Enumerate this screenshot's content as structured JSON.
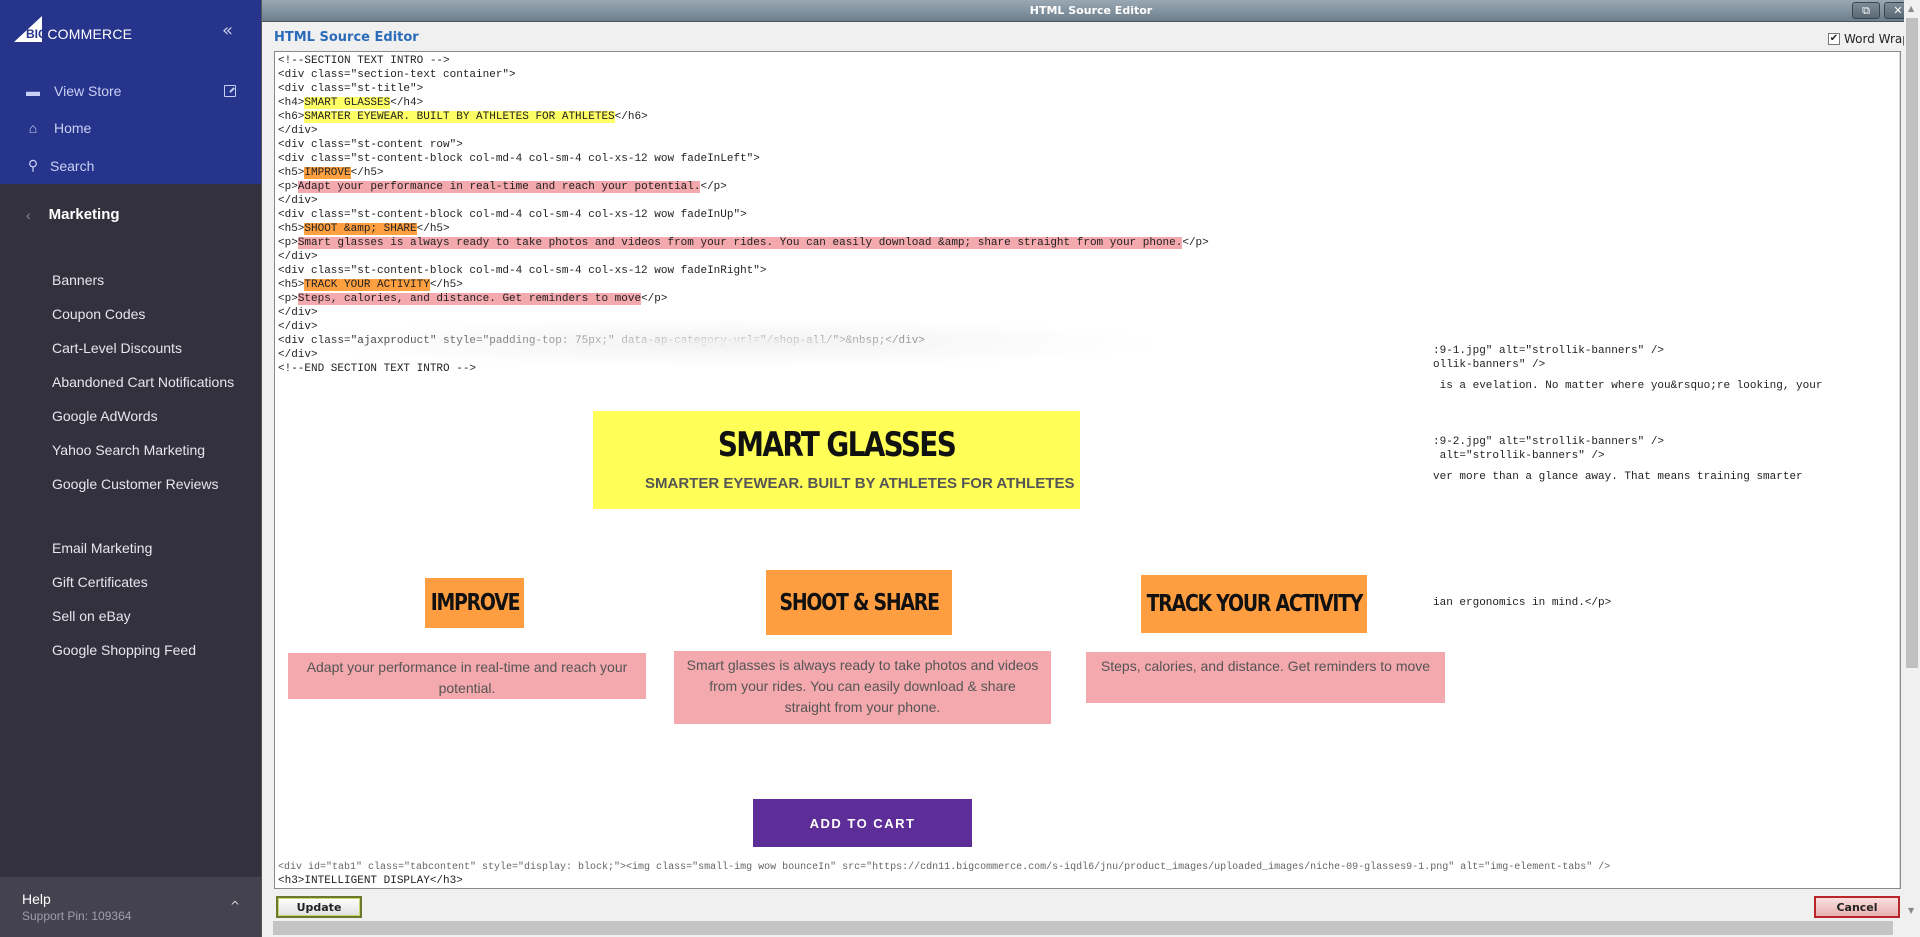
{
  "sidebar": {
    "brand": {
      "big": "BIG",
      "commerce": "COMMERCE"
    },
    "collapse_icon": "double-chevron-left",
    "top_links": [
      {
        "label": "View Store",
        "icon": "store-icon"
      },
      {
        "label": "Home",
        "icon": "home-icon"
      },
      {
        "label": "Search",
        "icon": "search-icon"
      }
    ],
    "section": {
      "label": "Marketing",
      "back_icon": "chevron-left"
    },
    "items": [
      {
        "label": "Banners"
      },
      {
        "label": "Coupon Codes"
      },
      {
        "label": "Cart-Level Discounts"
      },
      {
        "label": "Abandoned Cart Notifications"
      },
      {
        "label": "Google AdWords"
      },
      {
        "label": "Yahoo Search Marketing"
      },
      {
        "label": "Google Customer Reviews"
      },
      {
        "label": "Email Marketing"
      },
      {
        "label": "Gift Certificates"
      },
      {
        "label": "Sell on eBay"
      },
      {
        "label": "Google Shopping Feed"
      }
    ],
    "help": {
      "label": "Help",
      "support_pin": "Support Pin: 109364"
    }
  },
  "editor": {
    "window_title": "HTML Source Editor",
    "heading": "HTML Source Editor",
    "word_wrap": {
      "label": "Word Wrap",
      "checked": true
    },
    "code_lines": [
      {
        "pre": "<!--SECTION TEXT INTRO -->"
      },
      {
        "pre": "<div class=\"section-text container\">"
      },
      {
        "pre": "<div class=\"st-title\">"
      },
      {
        "pre": "<h4>",
        "hl": "SMART GLASSES",
        "hl_type": "y",
        "post": "</h4>"
      },
      {
        "pre": "<h6>",
        "hl": "SMARTER EYEWEAR. BUILT BY ATHLETES FOR ATHLETES",
        "hl_type": "y",
        "post": "</h6>"
      },
      {
        "pre": "</div>"
      },
      {
        "pre": "<div class=\"st-content row\">"
      },
      {
        "pre": "<div class=\"st-content-block col-md-4 col-sm-4 col-xs-12 wow fadeInLeft\">"
      },
      {
        "pre": "<h5>",
        "hl": "IMPROVE",
        "hl_type": "o",
        "post": "</h5>"
      },
      {
        "pre": "<p>",
        "hl": "Adapt your performance in real-time and reach your potential.",
        "hl_type": "p",
        "post": "</p>"
      },
      {
        "pre": "</div>"
      },
      {
        "pre": "<div class=\"st-content-block col-md-4 col-sm-4 col-xs-12 wow fadeInUp\">"
      },
      {
        "pre": "<h5>",
        "hl": "SHOOT &amp; SHARE",
        "hl_type": "o",
        "post": "</h5>"
      },
      {
        "pre": "<p>",
        "hl": "Smart glasses is always ready to take photos and videos from your rides. You can easily download &amp; share straight from your phone.",
        "hl_type": "p",
        "post": "</p>"
      },
      {
        "pre": "</div>"
      },
      {
        "pre": "<div class=\"st-content-block col-md-4 col-sm-4 col-xs-12 wow fadeInRight\">"
      },
      {
        "pre": "<h5>",
        "hl": "TRACK YOUR ACTIVITY",
        "hl_type": "o",
        "post": "</h5>"
      },
      {
        "pre": "<p>",
        "hl": "Steps, calories, and distance. Get reminders to move",
        "hl_type": "p",
        "post": "</p>"
      },
      {
        "pre": "</div>"
      },
      {
        "pre": "</div>"
      },
      {
        "pre": "<div class=\"ajaxproduct\" style=\"padding-top: 75px;\" data-ap-category-url=\"/shop-all/\">&nbsp;</div>"
      },
      {
        "pre": "</div>"
      },
      {
        "pre": "<!--END SECTION TEXT INTRO -->"
      }
    ],
    "right_fragments": [
      ":9-1.jpg\" alt=\"strollik-banners\" />",
      "ollik-banners\" />",
      " is a evelation. No matter where you&rsquo;re looking, your",
      ":9-2.jpg\" alt=\"strollik-banners\" />",
      " alt=\"strollik-banners\" />",
      "ver more than a glance away. That means training smarter",
      "ian ergonomics in mind.</p>"
    ],
    "bottom_lines": [
      "<div id=\"tab1\" class=\"tabcontent\" style=\"display: block;\"><img class=\"small-img wow bounceIn\" src=\"https://cdn11.bigcommerce.com/s-iqdl6/jnu/product_images/uploaded_images/niche-09-glasses9-1.png\" alt=\"img-element-tabs\" />",
      "<h3>INTELLIGENT DISPLAY</h3>"
    ],
    "update_label": "Update",
    "cancel_label": "Cancel"
  },
  "preview": {
    "title": "SMART GLASSES",
    "subtitle": "SMARTER EYEWEAR. BUILT BY ATHLETES FOR ATHLETES",
    "features": [
      {
        "title": "IMPROVE",
        "text": "Adapt your performance in real-time and reach your potential."
      },
      {
        "title": "SHOOT & SHARE",
        "text": "Smart glasses is always ready to take photos and videos from your rides. You can easily download & share straight from your phone."
      },
      {
        "title": "TRACK YOUR ACTIVITY",
        "text": "Steps, calories, and distance. Get reminders to move"
      }
    ],
    "cta": "ADD TO CART"
  },
  "colors": {
    "sidebar_top": "#27348b",
    "sidebar_bottom": "#34313f",
    "highlight_yellow": "#ffff57",
    "highlight_orange": "#ff9e40",
    "highlight_pink": "#f4a9ae",
    "cta_purple": "#5e2e98"
  }
}
